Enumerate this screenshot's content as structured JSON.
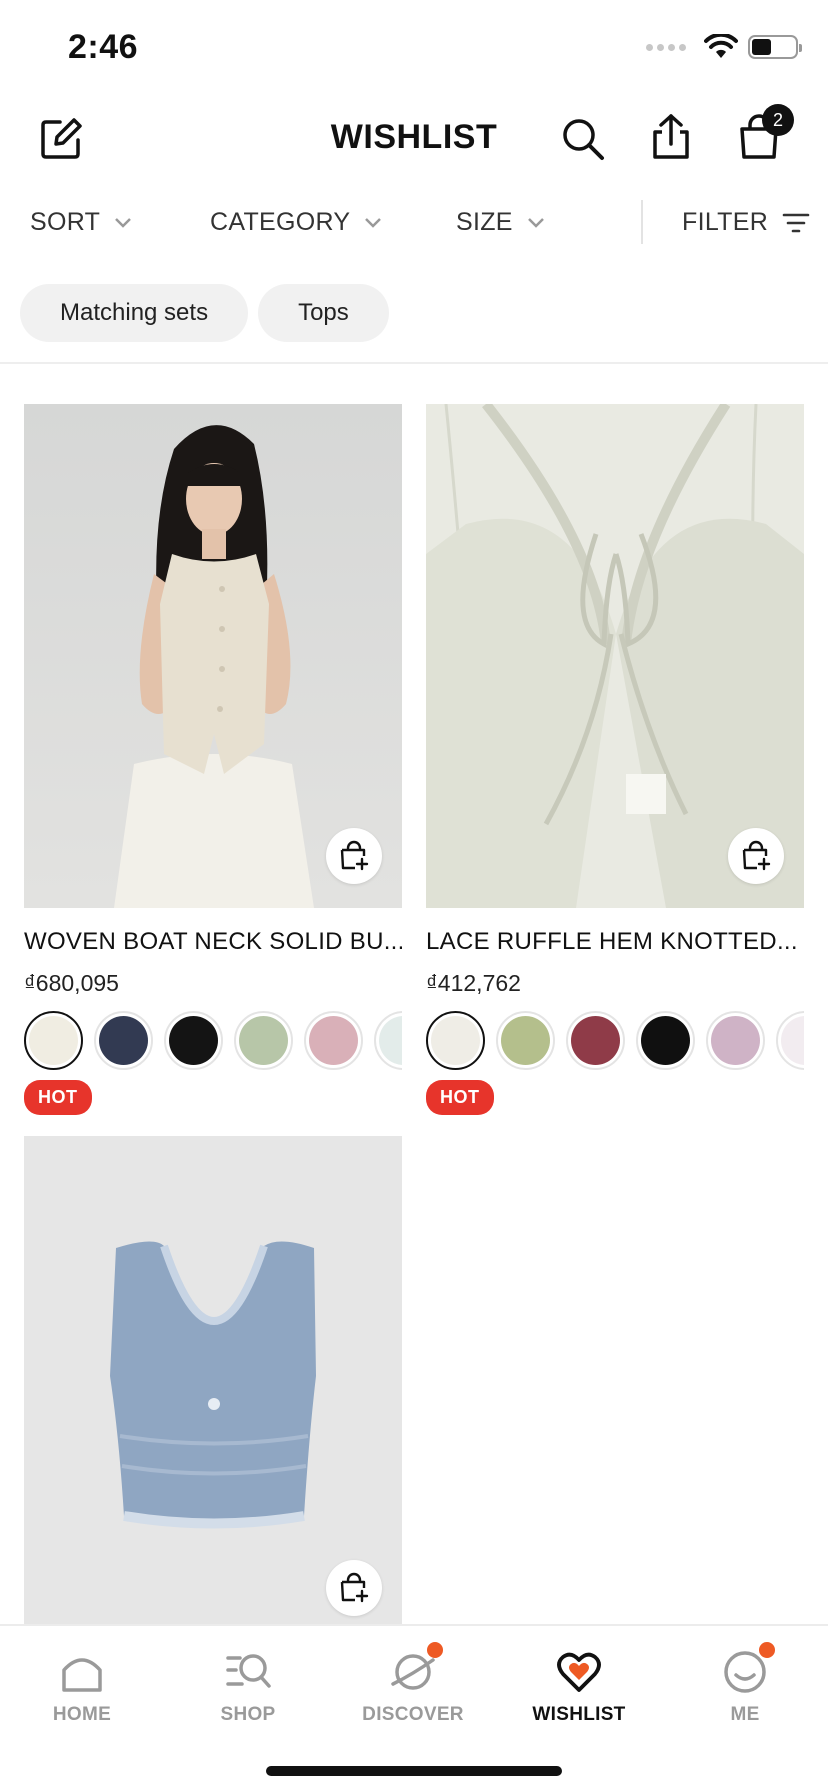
{
  "status_bar": {
    "time": "2:46"
  },
  "header": {
    "title": "WISHLIST",
    "bag_count": "2",
    "icons": {
      "edit": "edit-icon",
      "search": "search-icon",
      "share": "share-icon",
      "bag": "shopping-bag-icon"
    }
  },
  "filters": {
    "sort": "SORT",
    "category": "CATEGORY",
    "size": "SIZE",
    "filter": "FILTER"
  },
  "chips": [
    "Matching sets",
    "Tops"
  ],
  "products": [
    {
      "name": "WOVEN BOAT NECK SOLID BU...",
      "price": "₫680,095",
      "badge": "HOT",
      "swatches": [
        "#f0ede2",
        "#323a52",
        "#141414",
        "#b7c6a8",
        "#d9b0b8",
        "#e3ecea"
      ]
    },
    {
      "name": "LACE RUFFLE HEM KNOTTED...",
      "price": "₫412,762",
      "badge": "HOT",
      "swatches": [
        "#efede6",
        "#b4bf8c",
        "#8f3b48",
        "#101010",
        "#cfb3c6",
        "#f2ecf0"
      ]
    },
    {
      "name": "",
      "price": "",
      "badge": "",
      "swatches": []
    }
  ],
  "tabs": [
    {
      "label": "HOME",
      "icon": "home-icon",
      "active": false,
      "badge": false
    },
    {
      "label": "SHOP",
      "icon": "shop-search-icon",
      "active": false,
      "badge": false
    },
    {
      "label": "DISCOVER",
      "icon": "planet-icon",
      "active": false,
      "badge": true
    },
    {
      "label": "WISHLIST",
      "icon": "heart-icon",
      "active": true,
      "badge": false
    },
    {
      "label": "ME",
      "icon": "smiley-icon",
      "active": false,
      "badge": true
    }
  ],
  "colors": {
    "accent": "#ee5a24",
    "hot": "#e7342b",
    "text": "#111111"
  }
}
